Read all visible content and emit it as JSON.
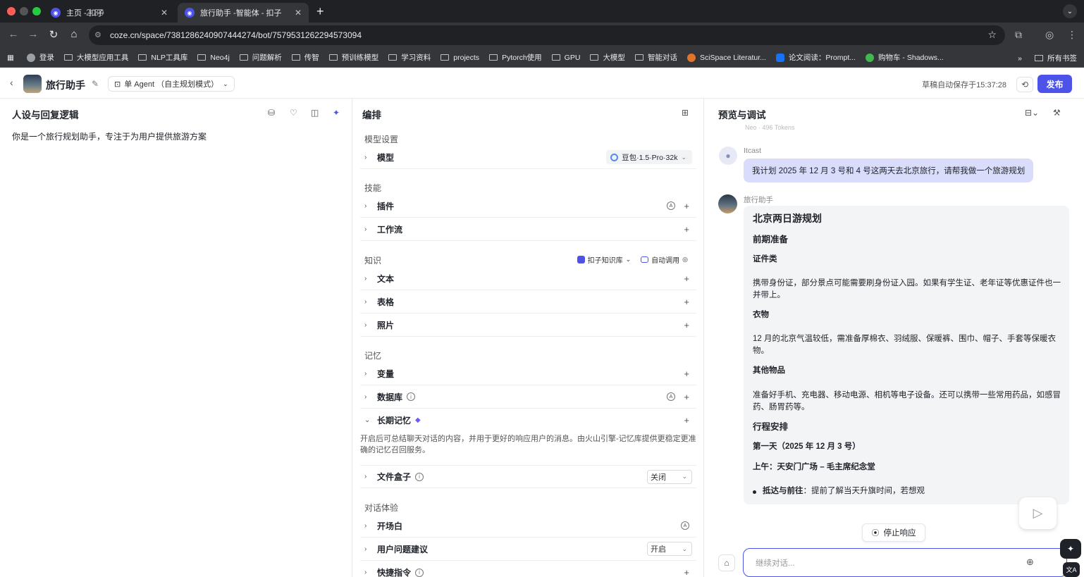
{
  "browser": {
    "tabs": [
      {
        "title": "主页 - 扣子",
        "active": false
      },
      {
        "title": "旅行助手 -智能体 - 扣子",
        "active": true
      }
    ],
    "tab_overlay_text": "2.80",
    "url": "coze.cn/space/7381286240907444274/bot/7579531262294573094",
    "bookmarks": [
      {
        "label": "登录",
        "icon": "globe-icon"
      },
      {
        "label": "大模型应用工具",
        "icon": "folder-icon"
      },
      {
        "label": "NLP工具库",
        "icon": "folder-icon"
      },
      {
        "label": "Neo4j",
        "icon": "folder-icon"
      },
      {
        "label": "问题解析",
        "icon": "folder-icon"
      },
      {
        "label": "传智",
        "icon": "folder-icon"
      },
      {
        "label": "预训练模型",
        "icon": "folder-icon"
      },
      {
        "label": "学习资料",
        "icon": "folder-icon"
      },
      {
        "label": "projects",
        "icon": "folder-icon"
      },
      {
        "label": "Pytorch使用",
        "icon": "folder-icon"
      },
      {
        "label": "GPU",
        "icon": "folder-icon"
      },
      {
        "label": "大模型",
        "icon": "folder-icon"
      },
      {
        "label": "智能对话",
        "icon": "folder-icon"
      },
      {
        "label": "SciSpace Literatur...",
        "icon": "scispace-icon"
      },
      {
        "label": "论文阅读：Prompt...",
        "icon": "zhihu-icon"
      },
      {
        "label": "购物车 - Shadows...",
        "icon": "cart-icon"
      }
    ],
    "all_bookmarks": "所有书签"
  },
  "header": {
    "bot_name": "旅行助手",
    "mode": "单 Agent （自主规划模式）",
    "autosave": "草稿自动保存于15:37:28",
    "publish": "发布"
  },
  "left_panel": {
    "title": "人设与回复逻辑",
    "persona": "你是一个旅行规划助手，专注于为用户提供旅游方案"
  },
  "mid_panel": {
    "title": "编排",
    "sections": {
      "model_settings": "模型设置",
      "skills": "技能",
      "knowledge": "知识",
      "memory": "记忆",
      "conversation": "对话体验"
    },
    "model": {
      "label": "模型",
      "value": "豆包·1.5·Pro·32k"
    },
    "plugins": "插件",
    "workflow": "工作流",
    "knowledge_source": "扣子知识库",
    "auto_call": "自动调用",
    "text": "文本",
    "table": "表格",
    "photo": "照片",
    "variable": "变量",
    "database": "数据库",
    "long_term_memory": "长期记忆",
    "ltm_desc": "开启后可总结聊天对话的内容，并用于更好的响应用户的消息。由火山引擎-记忆库提供更稳定更准确的记忆召回服务。",
    "file_box": {
      "label": "文件盒子",
      "value": "关闭"
    },
    "opening": "开场白",
    "suggestions": {
      "label": "用户问题建议",
      "value": "开启"
    },
    "shortcuts": "快捷指令"
  },
  "right_panel": {
    "title": "预览与调试",
    "faded": "Neo · 496 Tokens",
    "user_name": "Itcast",
    "user_message": "我计划 2025 年 12 月 3 号和 4 号这两天去北京旅行，请帮我做一个旅游规划",
    "bot_name": "旅行助手",
    "reply": {
      "h1": "北京两日游规划",
      "prep": "前期准备",
      "docs_h": "证件类",
      "docs_p": "携带身份证，部分景点可能需要刷身份证入园。如果有学生证、老年证等优惠证件也一并带上。",
      "clothes_h": "衣物",
      "clothes_p": "12 月的北京气温较低，需准备厚棉衣、羽绒服、保暖裤、围巾、帽子、手套等保暖衣物。",
      "other_h": "其他物品",
      "other_p": "准备好手机、充电器、移动电源、相机等电子设备。还可以携带一些常用药品，如感冒药、肠胃药等。",
      "itinerary": "行程安排",
      "day1": "第一天（2025 年 12 月 3 号）",
      "morning": "上午：天安门广场 – 毛主席纪念堂",
      "bullet_bold": "抵达与前往",
      "bullet_text": "：提前了解当天升旗时间，若想观"
    },
    "stop": "停止响应",
    "input_placeholder": "继续对话..."
  },
  "colors": {
    "accent": "#4d53e8",
    "user_bubble": "#d9dcfa",
    "bot_bubble": "#f3f4f6"
  }
}
